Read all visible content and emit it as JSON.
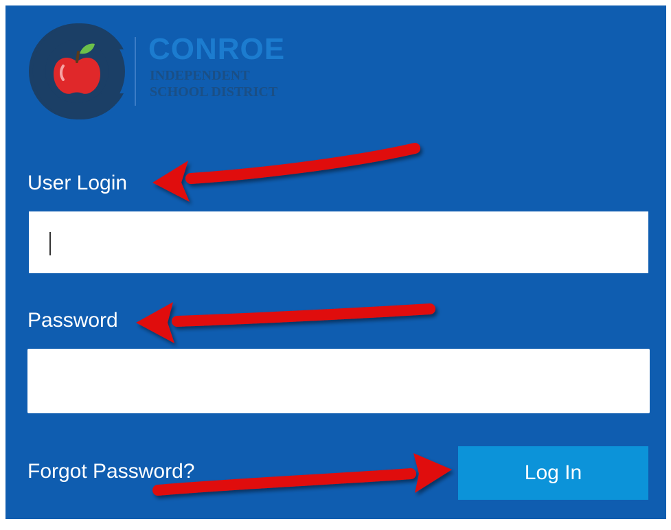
{
  "brand": {
    "name": "CONROE",
    "subtitle_line1": "INDEPENDENT",
    "subtitle_line2": "SCHOOL DISTRICT",
    "logo_icon": "apple-c-logo-icon"
  },
  "form": {
    "user_label": "User Login",
    "user_value": "",
    "password_label": "Password",
    "password_value": "",
    "forgot_link": "Forgot Password?",
    "login_button": "Log In"
  },
  "annotations": {
    "arrow_icon": "red-arrow-icon",
    "arrow_color": "#e01010"
  },
  "colors": {
    "panel_bg": "#0f5db0",
    "button_bg": "#0c93d9",
    "brand_text": "#1c7ccf",
    "apple_red": "#e0282a",
    "leaf_green": "#6cc04a"
  }
}
